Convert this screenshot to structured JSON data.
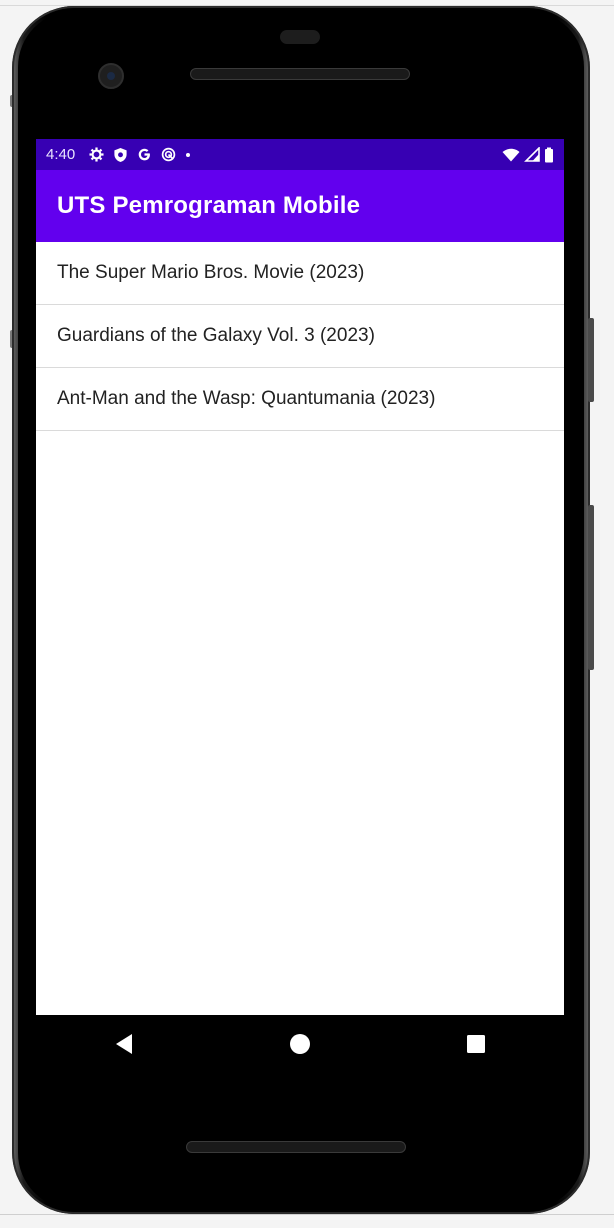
{
  "status_bar": {
    "time": "4:40",
    "icons_left": [
      "gear-icon",
      "shield-icon",
      "google-icon",
      "sync-icon",
      "dot-icon"
    ],
    "icons_right": [
      "wifi-icon",
      "signal-icon",
      "battery-icon"
    ]
  },
  "app_bar": {
    "title": "UTS Pemrograman Mobile"
  },
  "movies": [
    {
      "title": "The Super Mario Bros. Movie (2023)"
    },
    {
      "title": "Guardians of the Galaxy Vol. 3 (2023)"
    },
    {
      "title": "Ant-Man and the Wasp: Quantumania (2023)"
    }
  ],
  "nav_bar": {
    "buttons": [
      "back-icon",
      "home-icon",
      "recents-icon"
    ]
  },
  "colors": {
    "status_bar": "#3700b3",
    "app_bar": "#6200ee",
    "screen_bg": "#ffffff",
    "text": "#222222"
  }
}
